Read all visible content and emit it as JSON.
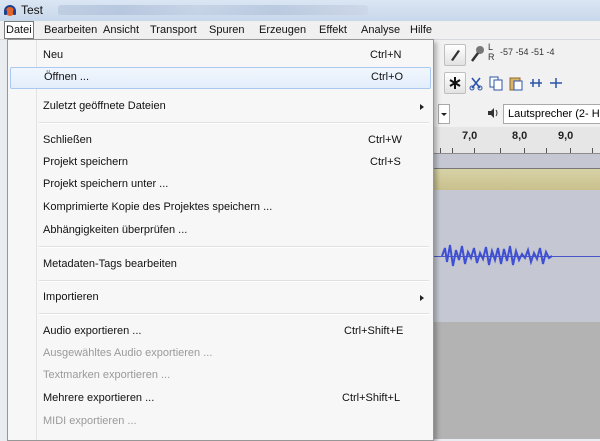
{
  "window": {
    "title": "Test"
  },
  "menubar": {
    "items": [
      "Datei",
      "Bearbeiten",
      "Ansicht",
      "Transport",
      "Spuren",
      "Erzeugen",
      "Effekt",
      "Analyse",
      "Hilfe"
    ]
  },
  "file_menu": {
    "items": [
      {
        "label": "Neu",
        "shortcut": "Ctrl+N"
      },
      {
        "label": "Öffnen ...",
        "shortcut": "Ctrl+O"
      },
      {
        "label": "Zuletzt geöffnete Dateien"
      },
      {
        "label": "Schließen",
        "shortcut": "Ctrl+W"
      },
      {
        "label": "Projekt speichern",
        "shortcut": "Ctrl+S"
      },
      {
        "label": "Projekt speichern unter ..."
      },
      {
        "label": "Komprimierte Kopie des Projektes speichern ..."
      },
      {
        "label": "Abhängigkeiten überprüfen ..."
      },
      {
        "label": "Metadaten-Tags bearbeiten"
      },
      {
        "label": "Importieren"
      },
      {
        "label": "Audio exportieren ...",
        "shortcut": "Ctrl+Shift+E"
      },
      {
        "label": "Ausgewähltes Audio exportieren ..."
      },
      {
        "label": "Textmarken exportieren ..."
      },
      {
        "label": "Mehrere exportieren ...",
        "shortcut": "Ctrl+Shift+L"
      },
      {
        "label": "MIDI exportieren ..."
      }
    ]
  },
  "toolbar": {
    "meter_l": "L",
    "meter_r": "R",
    "meter_scale": "-57 -54 -51 -4",
    "device": "Lautsprecher (2- High"
  },
  "timeline": {
    "ticks": [
      "7,0",
      "8,0",
      "9,0"
    ]
  },
  "colors": {
    "highlight": "#e3eefb",
    "waveform": "#3f4fd1",
    "menu_bg": "#f7f7f7"
  }
}
